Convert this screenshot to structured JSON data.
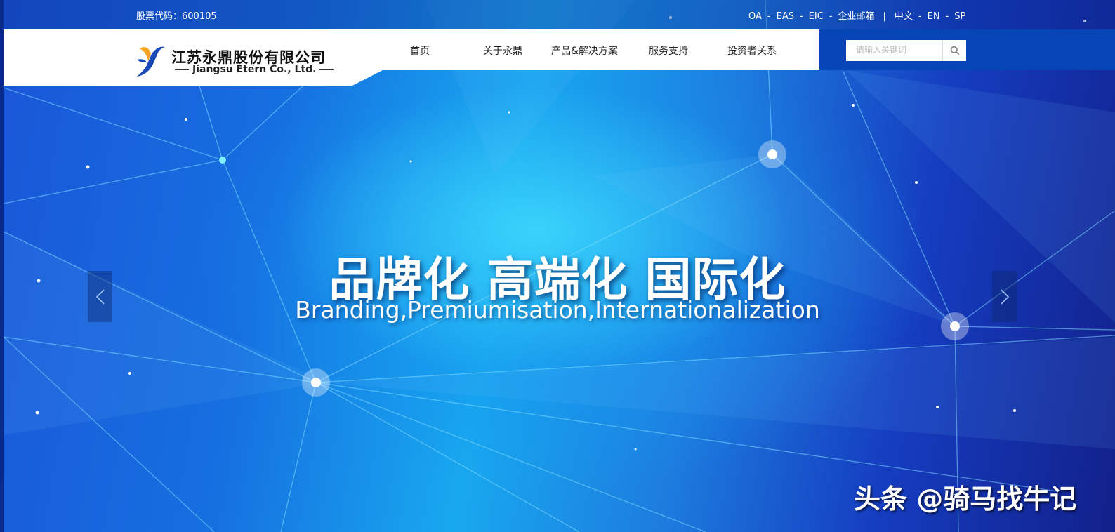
{
  "topbar": {
    "stock_code": "股票代码：600105",
    "links": {
      "oa": "OA",
      "eas": "EAS",
      "eic": "EIC",
      "mail": "企业邮箱"
    },
    "dash": "-",
    "divider": "|",
    "lang": {
      "cn": "中文",
      "en": "EN",
      "sp": "SP"
    }
  },
  "brand": {
    "name_cn": "江苏永鼎股份有限公司",
    "name_en": "Jiangsu Etern Co., Ltd.",
    "colors": {
      "logo_yellow": "#f5a623",
      "logo_blue": "#1a49b8"
    }
  },
  "nav": {
    "items": [
      {
        "label": "首页"
      },
      {
        "label": "关于永鼎"
      },
      {
        "label": "产品&解决方案"
      },
      {
        "label": "服务支持"
      },
      {
        "label": "投资者关系"
      }
    ]
  },
  "search": {
    "placeholder": "请输入关键词",
    "icon": "search-icon"
  },
  "banner": {
    "headline": "品牌化 高端化 国际化",
    "subheadline": "Branding,Premiumisation,Internationalization",
    "prev_icon": "chevron-left-icon",
    "next_icon": "chevron-right-icon"
  },
  "watermark": "头条 @骑马找牛记",
  "colors": {
    "nav_blue": "#0545b5",
    "hero_cyan": "#46e6ff",
    "hero_blue": "#153dc0"
  }
}
